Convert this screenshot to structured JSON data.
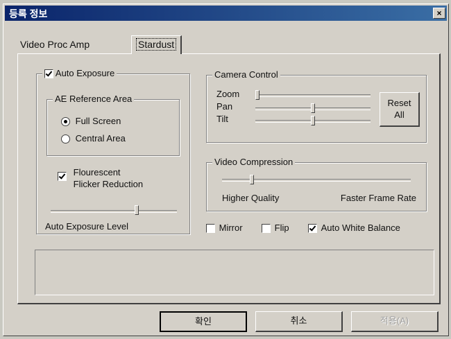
{
  "window": {
    "title": "등록 정보",
    "close_glyph": "×"
  },
  "tabs": [
    {
      "label": "Video Proc Amp",
      "active": false
    },
    {
      "label": "Stardust",
      "active": true
    }
  ],
  "auto_exposure": {
    "label": "Auto Exposure",
    "checked": true,
    "ae_reference": {
      "legend": "AE Reference Area",
      "options": [
        {
          "label": "Full Screen",
          "selected": true
        },
        {
          "label": "Central Area",
          "selected": false
        }
      ]
    },
    "flicker": {
      "label_line1": "Flourescent",
      "label_line2": "Flicker Reduction",
      "checked": true
    },
    "level": {
      "label": "Auto Exposure Level",
      "value": 0.69
    }
  },
  "camera_control": {
    "legend": "Camera Control",
    "sliders": [
      {
        "label": "Zoom",
        "value": 0.0
      },
      {
        "label": "Pan",
        "value": 0.5
      },
      {
        "label": "Tilt",
        "value": 0.5
      }
    ],
    "reset_line1": "Reset",
    "reset_line2": "All"
  },
  "video_compression": {
    "legend": "Video Compression",
    "value": 0.15,
    "left_label": "Higher Quality",
    "right_label": "Faster Frame Rate"
  },
  "options": [
    {
      "label": "Mirror",
      "checked": false
    },
    {
      "label": "Flip",
      "checked": false
    },
    {
      "label": "Auto White Balance",
      "checked": true
    }
  ],
  "buttons": {
    "ok": "확인",
    "cancel": "취소",
    "apply": "적용(A)"
  },
  "colors": {
    "title_bar_start": "#0a246a",
    "title_bar_end": "#3a6ea5",
    "dialog_bg": "#d4d0c8"
  }
}
